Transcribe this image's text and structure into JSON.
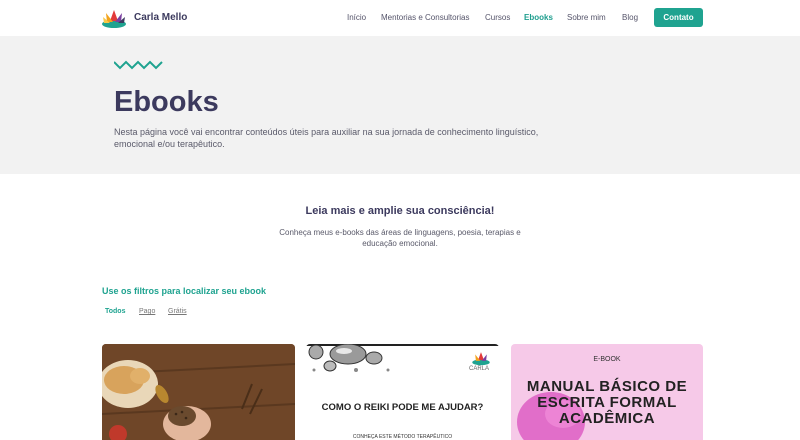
{
  "header": {
    "brand": "Carla Mello",
    "nav": [
      "Início",
      "Mentorias e Consultorias",
      "Cursos",
      "Ebooks",
      "Sobre mim",
      "Blog"
    ],
    "contact_label": "Contato"
  },
  "hero": {
    "title": "Ebooks",
    "subtitle": "Nesta página você vai encontrar conteúdos úteis para auxiliar na sua jornada de conhecimento linguístico, emocional e/ou terapêutico."
  },
  "intro": {
    "title": "Leia mais e amplie sua consciência!",
    "text": "Conheça meus e-books das áreas de linguagens, poesia, terapias e educação emocional."
  },
  "filters": {
    "title": "Use os filtros para localizar seu ebook",
    "options": [
      "Todos",
      "Pago",
      "Grátis"
    ]
  },
  "cards": [
    {
      "image": "bread-photo"
    },
    {
      "title": "COMO O REIKI PODE ME AJUDAR?",
      "subtitle": "CONHEÇA ESTE MÉTODO TERAPÊUTICO",
      "brand": "CARLA"
    },
    {
      "tag": "E-BOOK",
      "title": "MANUAL BÁSICO DE ESCRITA FORMAL ACADÊMICA"
    }
  ],
  "colors": {
    "accent": "#1fa390",
    "heading": "#3c3a5e",
    "hero_bg": "#f2f2f2"
  }
}
